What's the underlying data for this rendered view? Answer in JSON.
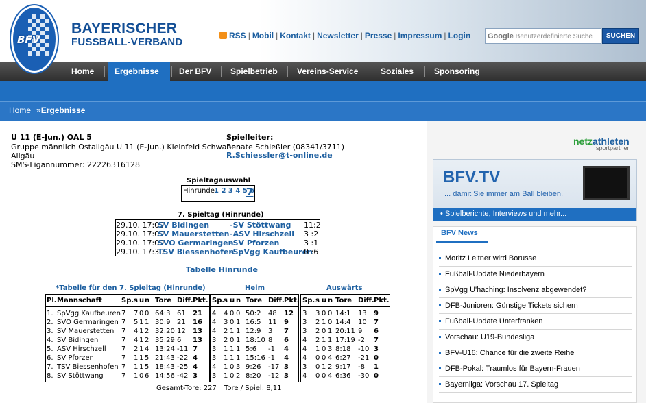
{
  "header": {
    "brand_line1": "BAYERISCHER",
    "brand_line2": "FUSSBALL-VERBAND",
    "logo_text": "BFV",
    "links": [
      "RSS",
      "Mobil",
      "Kontakt",
      "Newsletter",
      "Presse",
      "Impressum",
      "Login"
    ],
    "search_placeholder": "Benutzerdefinierte Suche",
    "search_brand": "Google",
    "search_button": "SUCHEN"
  },
  "nav": [
    "Home",
    "Ergebnisse",
    "Der BFV",
    "Spielbetrieb",
    "Vereins-Service",
    "Soziales",
    "Sponsoring"
  ],
  "breadcrumb": {
    "home": "Home",
    "current": "»Ergebnisse"
  },
  "league": {
    "title": "U 11 (E-Jun.) OAL 5",
    "group": "Gruppe männlich Ostallgäu U 11 (E-Jun.) Kleinfeld Schwaben",
    "region": "Allgäu",
    "sms": "SMS-Ligannummer: 22226316128"
  },
  "leader": {
    "label": "Spielleiter:",
    "name": "Renate Schießler (08341/3711)",
    "email": "R.Schiessler@t-online.de"
  },
  "matchday_select": {
    "label": "Spieltagauswahl",
    "round": "Hinrunde",
    "days": [
      "1",
      "2",
      "3",
      "4",
      "5",
      "6"
    ],
    "current": "7"
  },
  "matches": {
    "title": "7. Spieltag (Hinrunde)",
    "rows": [
      {
        "date": "29.10. 17:00",
        "home": "SV Bidingen",
        "away": "-SV Stöttwang",
        "score": "11:2"
      },
      {
        "date": "29.10. 17:00",
        "home": "SV Mauerstetten",
        "away": "-ASV Hirschzell",
        "score": "3 :2"
      },
      {
        "date": "29.10. 17:00",
        "home": "SVO Germaringen",
        "away": "-SV Pforzen",
        "score": "3 :1"
      },
      {
        "date": "29.10. 17:30",
        "home": "TSV Biessenhofen",
        "away": "-SpVgg Kaufbeuren",
        "score": "0 :6"
      }
    ]
  },
  "tabelle_link": "Tabelle Hinrunde",
  "standings": {
    "title": "*Tabelle für den 7. Spieltag (Hinrunde)",
    "heim": "Heim",
    "auswaerts": "Auswärts",
    "head": {
      "pl": "Pl.",
      "team": "Mannschaft",
      "sp": "Sp.",
      "s": "s",
      "u": "u",
      "n": "n",
      "tore": "Tore",
      "diff": "Diff.",
      "pkt": "Pkt."
    },
    "rows": [
      {
        "pl": "1.",
        "team": "SpVgg Kaufbeuren",
        "sp": "7",
        "s": "7",
        "u": "0",
        "n": "0",
        "tore": "64:3",
        "diff": "61",
        "pkt": "21",
        "h": [
          "4",
          "4",
          "0",
          "0",
          "50:2",
          "48",
          "12"
        ],
        "a": [
          "3",
          "3",
          "0",
          "0",
          "14:1",
          "13",
          "9"
        ]
      },
      {
        "pl": "2.",
        "team": "SVO Germaringen",
        "sp": "7",
        "s": "5",
        "u": "1",
        "n": "1",
        "tore": "30:9",
        "diff": "21",
        "pkt": "16",
        "h": [
          "4",
          "3",
          "0",
          "1",
          "16:5",
          "11",
          "9"
        ],
        "a": [
          "3",
          "2",
          "1",
          "0",
          "14:4",
          "10",
          "7"
        ]
      },
      {
        "pl": "3.",
        "team": "SV Mauerstetten",
        "sp": "7",
        "s": "4",
        "u": "1",
        "n": "2",
        "tore": "32:20",
        "diff": "12",
        "pkt": "13",
        "h": [
          "4",
          "2",
          "1",
          "1",
          "12:9",
          "3",
          "7"
        ],
        "a": [
          "3",
          "2",
          "0",
          "1",
          "20:11",
          "9",
          "6"
        ]
      },
      {
        "pl": "4.",
        "team": "SV Bidingen",
        "sp": "7",
        "s": "4",
        "u": "1",
        "n": "2",
        "tore": "35:29",
        "diff": "6",
        "pkt": "13",
        "h": [
          "3",
          "2",
          "0",
          "1",
          "18:10",
          "8",
          "6"
        ],
        "a": [
          "4",
          "2",
          "1",
          "1",
          "17:19",
          "-2",
          "7"
        ]
      },
      {
        "pl": "5.",
        "team": "ASV Hirschzell",
        "sp": "7",
        "s": "2",
        "u": "1",
        "n": "4",
        "tore": "13:24",
        "diff": "-11",
        "pkt": "7",
        "h": [
          "3",
          "1",
          "1",
          "1",
          "5:6",
          "-1",
          "4"
        ],
        "a": [
          "4",
          "1",
          "0",
          "3",
          "8:18",
          "-10",
          "3"
        ]
      },
      {
        "pl": "6.",
        "team": "SV Pforzen",
        "sp": "7",
        "s": "1",
        "u": "1",
        "n": "5",
        "tore": "21:43",
        "diff": "-22",
        "pkt": "4",
        "h": [
          "3",
          "1",
          "1",
          "1",
          "15:16",
          "-1",
          "4"
        ],
        "a": [
          "4",
          "0",
          "0",
          "4",
          "6:27",
          "-21",
          "0"
        ]
      },
      {
        "pl": "7.",
        "team": "TSV Biessenhofen",
        "sp": "7",
        "s": "1",
        "u": "1",
        "n": "5",
        "tore": "18:43",
        "diff": "-25",
        "pkt": "4",
        "h": [
          "4",
          "1",
          "0",
          "3",
          "9:26",
          "-17",
          "3"
        ],
        "a": [
          "3",
          "0",
          "1",
          "2",
          "9:17",
          "-8",
          "1"
        ]
      },
      {
        "pl": "8.",
        "team": "SV Stöttwang",
        "sp": "7",
        "s": "1",
        "u": "0",
        "n": "6",
        "tore": "14:56",
        "diff": "-42",
        "pkt": "3",
        "h": [
          "3",
          "1",
          "0",
          "2",
          "8:20",
          "-12",
          "3"
        ],
        "a": [
          "4",
          "0",
          "0",
          "4",
          "6:36",
          "-30",
          "0"
        ]
      }
    ],
    "footer_total": "Gesamt-Tore: 227",
    "footer_avg": "Tore / Spiel: 8,11"
  },
  "sidebar": {
    "netz": "netz",
    "athleten": "athleten",
    "sportpartner": "sportpartner",
    "ad_title": "BFV.TV",
    "ad_sub": "... damit Sie immer am Ball bleiben.",
    "ad_bar": "• Spielberichte, Interviews und mehr...",
    "news_tab": "BFV News",
    "news": [
      "Moritz Leitner wird Borusse",
      "Fußball-Update Niederbayern",
      "SpVgg U'haching: Insolvenz abgewendet?",
      "DFB-Junioren: Günstige Tickets sichern",
      "Fußball-Update Unterfranken",
      "Vorschau: U19-Bundesliga",
      "BFV-U16: Chance für die zweite Reihe",
      "DFB-Pokal: Traumlos für Bayern-Frauen",
      "Bayernliga: Vorschau 17. Spieltag"
    ]
  }
}
